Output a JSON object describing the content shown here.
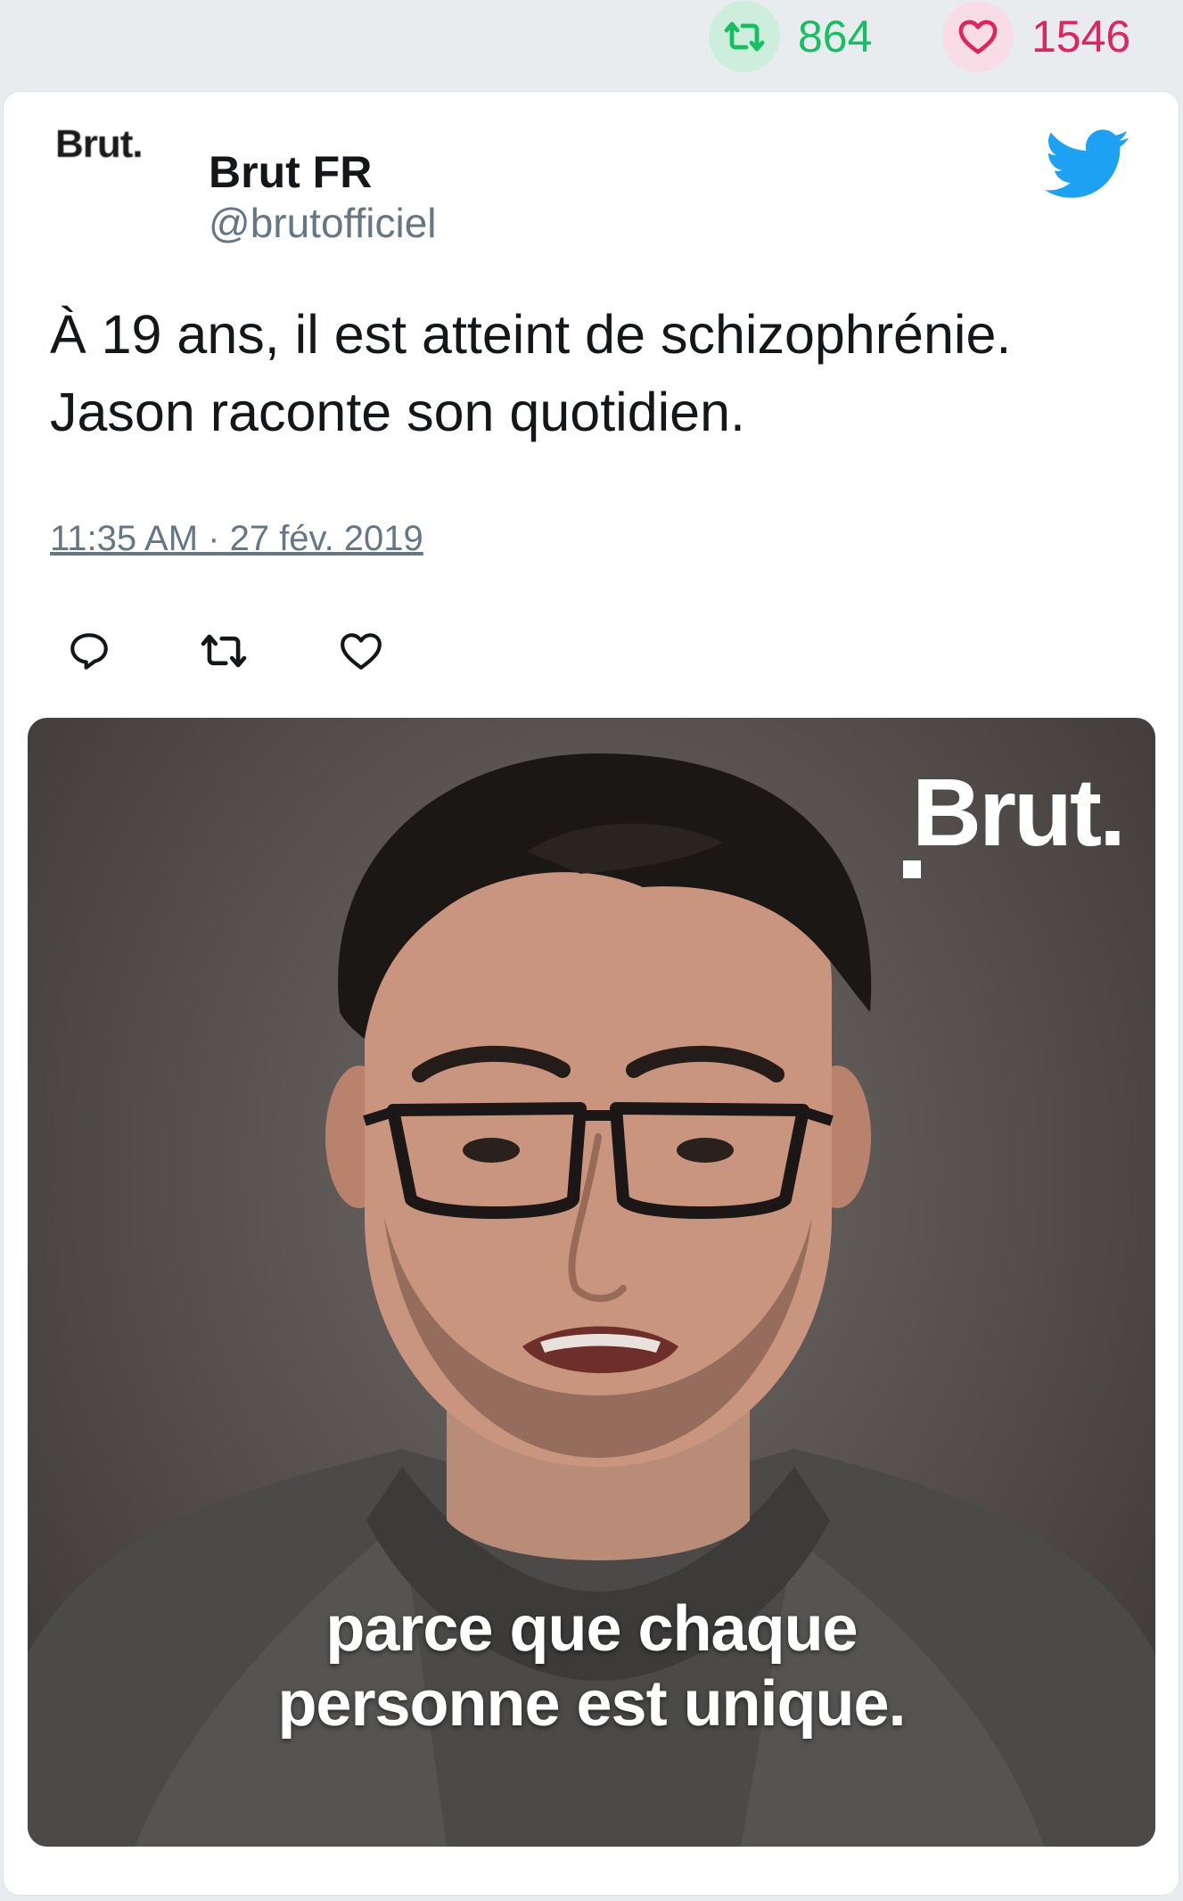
{
  "stats": {
    "retweet_count": "864",
    "like_count": "1546"
  },
  "author": {
    "avatar_text": "Brut.",
    "name": "Brut FR",
    "handle": "@brutofficiel"
  },
  "tweet": {
    "lines": [
      "À 19 ans, il est atteint de schizophrénie.",
      "Jason raconte son quotidien."
    ],
    "timestamp": "11:35 AM · 27 fév. 2019"
  },
  "actions": {
    "icons": [
      "reply-icon",
      "retweet-icon",
      "like-icon"
    ]
  },
  "media": {
    "logo_text": "Brut.",
    "caption_lines": [
      "parce que chaque",
      "personne est unique."
    ]
  },
  "colors": {
    "retweet_green": "#17bf63",
    "like_red": "#e0245e",
    "twitter_blue": "#1da1f2",
    "handle_gray": "#657786",
    "text_dark": "#14171a",
    "page_bg": "#e9ecef"
  }
}
